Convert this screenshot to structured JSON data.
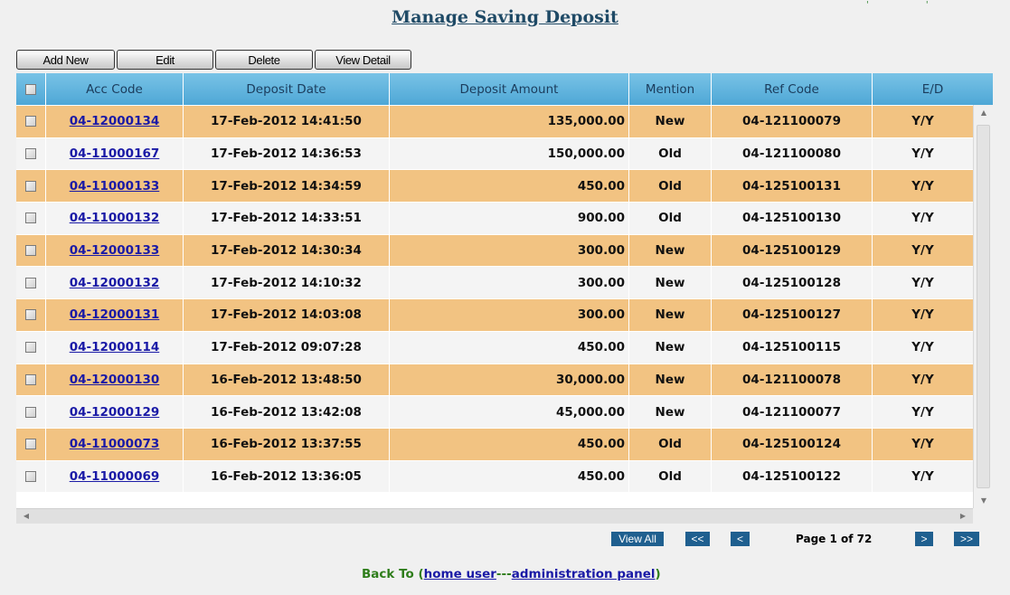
{
  "page": {
    "title": "Manage Saving Deposit",
    "corner_marks": "' '"
  },
  "toolbar": {
    "add_new": "Add New",
    "edit": "Edit",
    "delete": "Delete",
    "view_detail": "View Detail"
  },
  "table": {
    "columns": [
      "Acc Code",
      "Deposit Date",
      "Deposit Amount",
      "Mention",
      "Ref Code",
      "E/D"
    ],
    "rows": [
      {
        "acc": "04-12000134",
        "date": "17-Feb-2012 14:41:50",
        "amount": "135,000.00",
        "mention": "New",
        "ref": "04-121100079",
        "ed": "Y/Y"
      },
      {
        "acc": "04-11000167",
        "date": "17-Feb-2012 14:36:53",
        "amount": "150,000.00",
        "mention": "Old",
        "ref": "04-121100080",
        "ed": "Y/Y"
      },
      {
        "acc": "04-11000133",
        "date": "17-Feb-2012 14:34:59",
        "amount": "450.00",
        "mention": "Old",
        "ref": "04-125100131",
        "ed": "Y/Y"
      },
      {
        "acc": "04-11000132",
        "date": "17-Feb-2012 14:33:51",
        "amount": "900.00",
        "mention": "Old",
        "ref": "04-125100130",
        "ed": "Y/Y"
      },
      {
        "acc": "04-12000133",
        "date": "17-Feb-2012 14:30:34",
        "amount": "300.00",
        "mention": "New",
        "ref": "04-125100129",
        "ed": "Y/Y"
      },
      {
        "acc": "04-12000132",
        "date": "17-Feb-2012 14:10:32",
        "amount": "300.00",
        "mention": "New",
        "ref": "04-125100128",
        "ed": "Y/Y"
      },
      {
        "acc": "04-12000131",
        "date": "17-Feb-2012 14:03:08",
        "amount": "300.00",
        "mention": "New",
        "ref": "04-125100127",
        "ed": "Y/Y"
      },
      {
        "acc": "04-12000114",
        "date": "17-Feb-2012 09:07:28",
        "amount": "450.00",
        "mention": "New",
        "ref": "04-125100115",
        "ed": "Y/Y"
      },
      {
        "acc": "04-12000130",
        "date": "16-Feb-2012 13:48:50",
        "amount": "30,000.00",
        "mention": "New",
        "ref": "04-121100078",
        "ed": "Y/Y"
      },
      {
        "acc": "04-12000129",
        "date": "16-Feb-2012 13:42:08",
        "amount": "45,000.00",
        "mention": "New",
        "ref": "04-121100077",
        "ed": "Y/Y"
      },
      {
        "acc": "04-11000073",
        "date": "16-Feb-2012 13:37:55",
        "amount": "450.00",
        "mention": "Old",
        "ref": "04-125100124",
        "ed": "Y/Y"
      },
      {
        "acc": "04-11000069",
        "date": "16-Feb-2012 13:36:05",
        "amount": "450.00",
        "mention": "Old",
        "ref": "04-125100122",
        "ed": "Y/Y"
      }
    ]
  },
  "pager": {
    "view_all": "View All",
    "first": "<<",
    "prev": "<",
    "page_info": "Page 1 of 72",
    "next": ">",
    "last": ">>"
  },
  "footer": {
    "back_to": "Back To (",
    "home_user": "home user",
    "separator": "---",
    "admin_panel": "administration panel",
    "close": ")"
  },
  "colors": {
    "row_highlight": "#f2c382",
    "row_plain": "#f4f4f4",
    "header": "#5ab0dc",
    "link": "#1a1aa6",
    "pager_button": "#1f5f8f",
    "footer_text": "#2e7d1a"
  },
  "icons": {
    "scroll_up": "triangle-up-icon",
    "scroll_down": "triangle-down-icon",
    "scroll_left": "triangle-left-icon",
    "scroll_right": "triangle-right-icon"
  }
}
